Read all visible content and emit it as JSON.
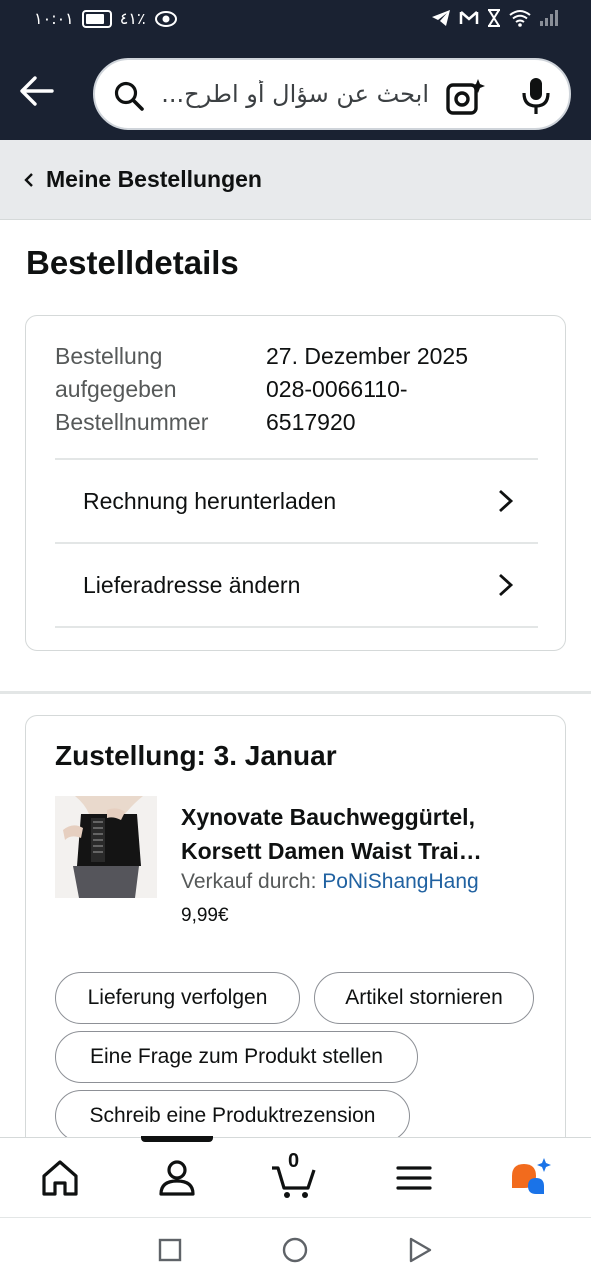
{
  "status_bar": {
    "time": "١٠:٠١",
    "battery": "٤١٪"
  },
  "header": {
    "search_placeholder": "ابحث عن سؤال أو اطرح..."
  },
  "breadcrumb": {
    "label": "Meine Bestellungen"
  },
  "page": {
    "title": "Bestelldetails"
  },
  "order": {
    "placed_label_line1": "Bestellung",
    "placed_label_line2": "aufgegeben",
    "number_label": "Bestellnummer",
    "placed_date": "27. Dezember 2025",
    "number_line1": "028-0066110-",
    "number_line2": "6517920",
    "links": [
      {
        "label": "Rechnung herunterladen"
      },
      {
        "label": "Lieferadresse ändern"
      }
    ]
  },
  "shipment": {
    "delivery_title": "Zustellung: 3. Januar",
    "product_title": "Xynovate Bauchweggürtel, Korsett Damen Waist Trai…",
    "seller_prefix": "Verkauf durch: ",
    "seller_name": "PoNiShangHang",
    "price": "9,99€",
    "actions": [
      {
        "label": "Lieferung verfolgen"
      },
      {
        "label": "Artikel stornieren"
      },
      {
        "label": "Eine Frage zum Produkt stellen"
      },
      {
        "label": "Schreib eine Produktrezension"
      }
    ]
  },
  "bottom_nav": {
    "cart_count": "0",
    "active": "account"
  },
  "colors": {
    "header_bg": "#1a2232",
    "link": "#2162a1",
    "ai_orange": "#f26b1d",
    "ai_blue": "#1a73e8"
  }
}
